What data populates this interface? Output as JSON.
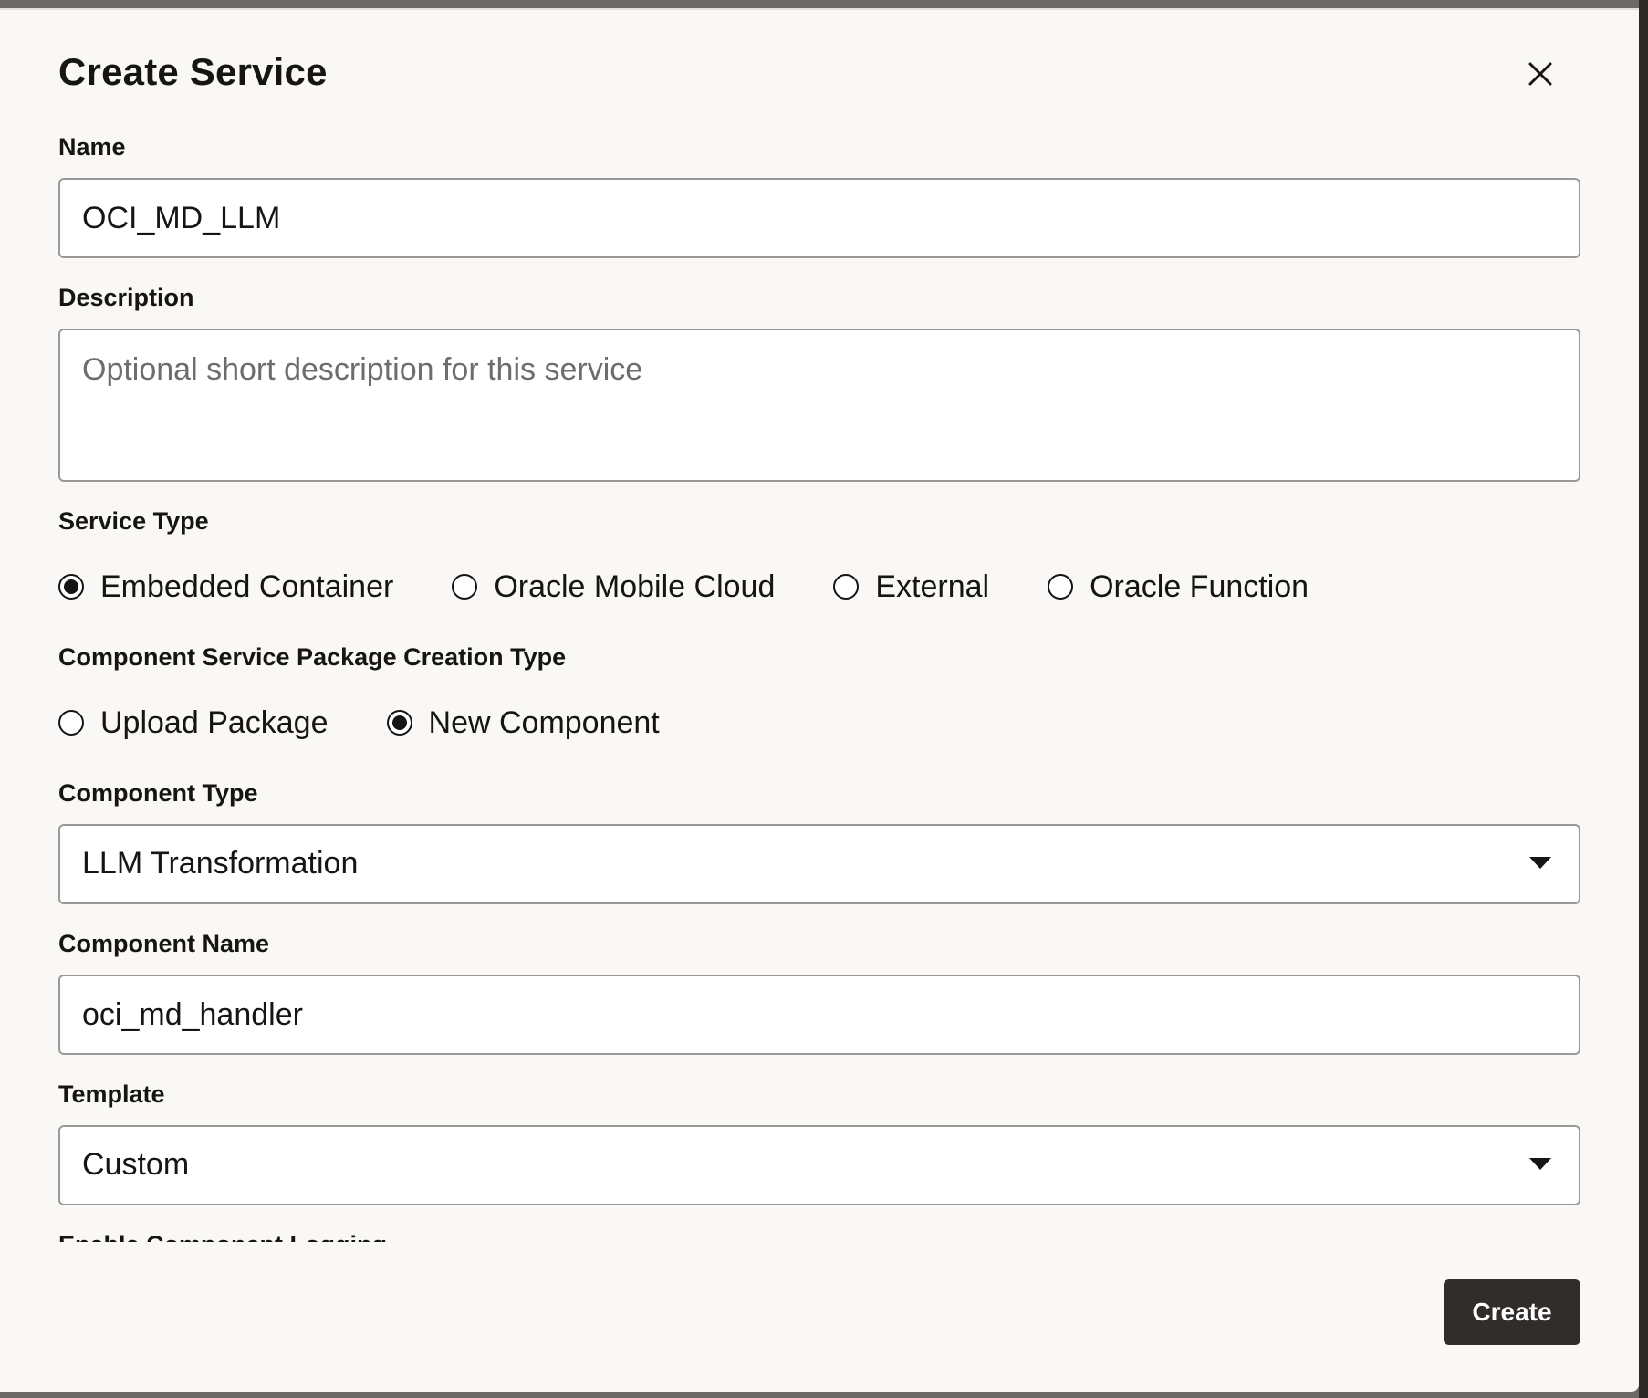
{
  "dialog": {
    "title": "Create Service",
    "close_icon": "close-icon"
  },
  "name": {
    "label": "Name",
    "value": "OCI_MD_LLM"
  },
  "description": {
    "label": "Description",
    "value": "",
    "placeholder": "Optional short description for this service"
  },
  "service_type": {
    "label": "Service Type",
    "options": [
      "Embedded Container",
      "Oracle Mobile Cloud",
      "External",
      "Oracle Function"
    ],
    "selected": "Embedded Container"
  },
  "package_creation": {
    "label": "Component Service Package Creation Type",
    "options": [
      "Upload Package",
      "New Component"
    ],
    "selected": "New Component"
  },
  "component_type": {
    "label": "Component Type",
    "value": "LLM Transformation"
  },
  "component_name": {
    "label": "Component Name",
    "value": "oci_md_handler"
  },
  "template": {
    "label": "Template",
    "value": "Custom"
  },
  "logging": {
    "label": "Enable Component Logging"
  },
  "footer": {
    "create_label": "Create"
  },
  "colors": {
    "primary_button": "#312d2a",
    "dialog_background": "#f9f8f6",
    "input_border": "#9b9995",
    "text": "#161513"
  }
}
